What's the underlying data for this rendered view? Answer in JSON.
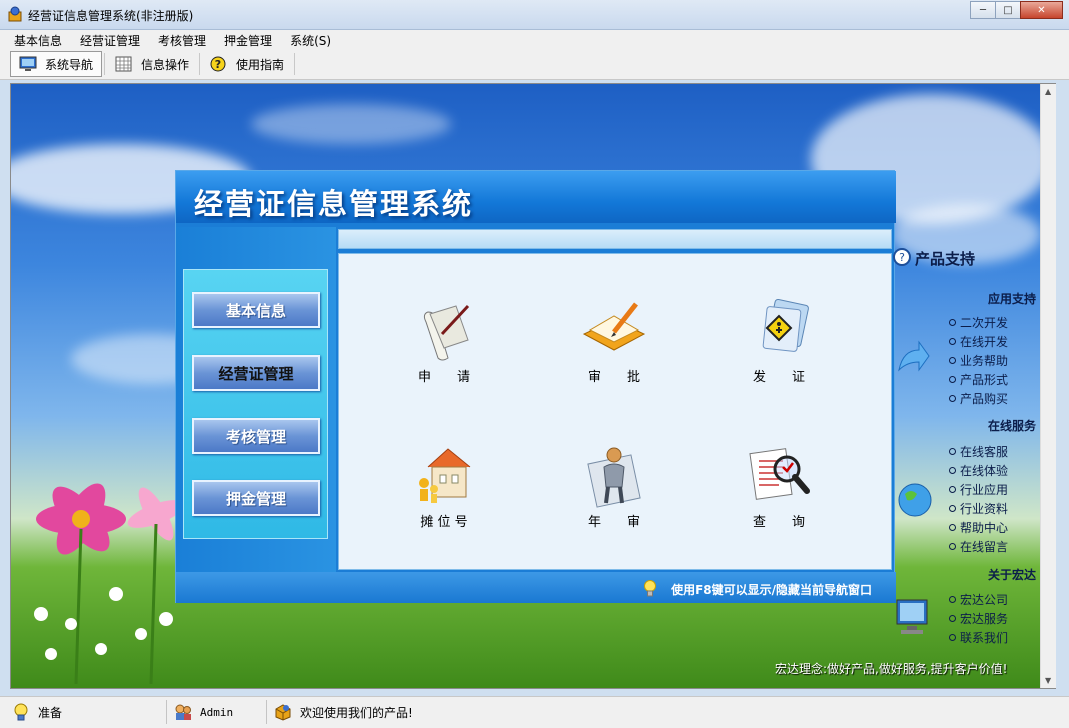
{
  "window": {
    "title": "经营证信息管理系统(非注册版)",
    "controls": {
      "minimize": "─",
      "maximize": "□",
      "close": "✕"
    }
  },
  "menu": [
    "基本信息",
    "经营证管理",
    "考核管理",
    "押金管理",
    "系统(S)"
  ],
  "toolbar": [
    {
      "label": "系统导航",
      "icon": "monitor-icon",
      "active": true
    },
    {
      "label": "信息操作",
      "icon": "grid-icon",
      "active": false
    },
    {
      "label": "使用指南",
      "icon": "help-icon",
      "active": false
    }
  ],
  "dialog": {
    "title": "经营证信息管理系统",
    "nav": [
      "基本信息",
      "经营证管理",
      "考核管理",
      "押金管理"
    ],
    "active_nav": "经营证管理",
    "functions": [
      {
        "label": "申　　请",
        "icon": "scroll-quill-icon"
      },
      {
        "label": "审　　批",
        "icon": "notebook-pen-icon"
      },
      {
        "label": "发　　证",
        "icon": "certificate-folder-icon"
      },
      {
        "label": "摊 位 号",
        "icon": "booth-building-icon"
      },
      {
        "label": "年　　审",
        "icon": "person-review-icon"
      },
      {
        "label": "查　　询",
        "icon": "magnifier-document-icon"
      }
    ],
    "hint": "使用F8键可以显示/隐藏当前导航窗口"
  },
  "right_panel": {
    "title": "产品支持",
    "sections": [
      {
        "heading": "应用支持",
        "links": [
          "二次开发",
          "在线开发",
          "业务帮助",
          "产品形式",
          "产品购买"
        ]
      },
      {
        "heading": "在线服务",
        "links": [
          "在线客服",
          "在线体验",
          "行业应用",
          "行业资料",
          "帮助中心",
          "在线留言"
        ]
      },
      {
        "heading": "关于宏达",
        "links": [
          "宏达公司",
          "宏达服务",
          "联系我们"
        ]
      }
    ],
    "slogan": "宏达理念:做好产品,做好服务,提升客户价值!"
  },
  "statusbar": {
    "status": "准备",
    "user": "Admin",
    "message": "欢迎使用我们的产品!"
  }
}
